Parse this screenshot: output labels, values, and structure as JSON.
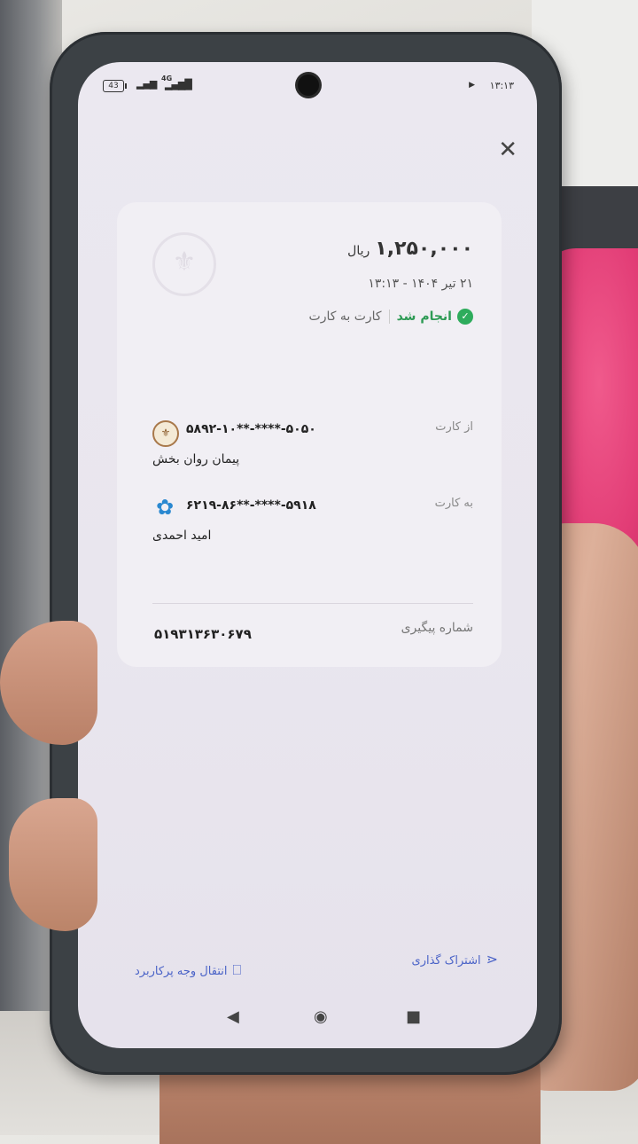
{
  "status_bar": {
    "battery": "43",
    "network": "4G",
    "time": "۱۳:۱۳"
  },
  "receipt": {
    "amount": "۱,۲۵۰,۰۰۰",
    "currency": "ریال",
    "date_time": "۲۱ تیر ۱۴۰۴ - ۱۳:۱۳",
    "status": "انجام شد",
    "transfer_type": "کارت به کارت",
    "from": {
      "label": "از کارت",
      "card_number": "۵۸۹۲-۱۰**-****-۵۰۵۰",
      "name": "پیمان روان بخش"
    },
    "to": {
      "label": "به کارت",
      "card_number": "۶۲۱۹-۸۶**-****-۵۹۱۸",
      "name": "امید احمدی"
    },
    "tracking": {
      "label": "شماره پیگیری",
      "value": "۵۱۹۳۱۳۶۳۰۶۷۹"
    }
  },
  "actions": {
    "share": "اشتراک گذاری",
    "save_transfer": "انتقال وجه پرکاربرد"
  },
  "icons": {
    "close": "close-icon",
    "share": "share-icon",
    "bookmark": "bookmark-icon",
    "check": "check-circle-icon"
  },
  "colors": {
    "success": "#2eac5c",
    "accent": "#4a63c7"
  }
}
